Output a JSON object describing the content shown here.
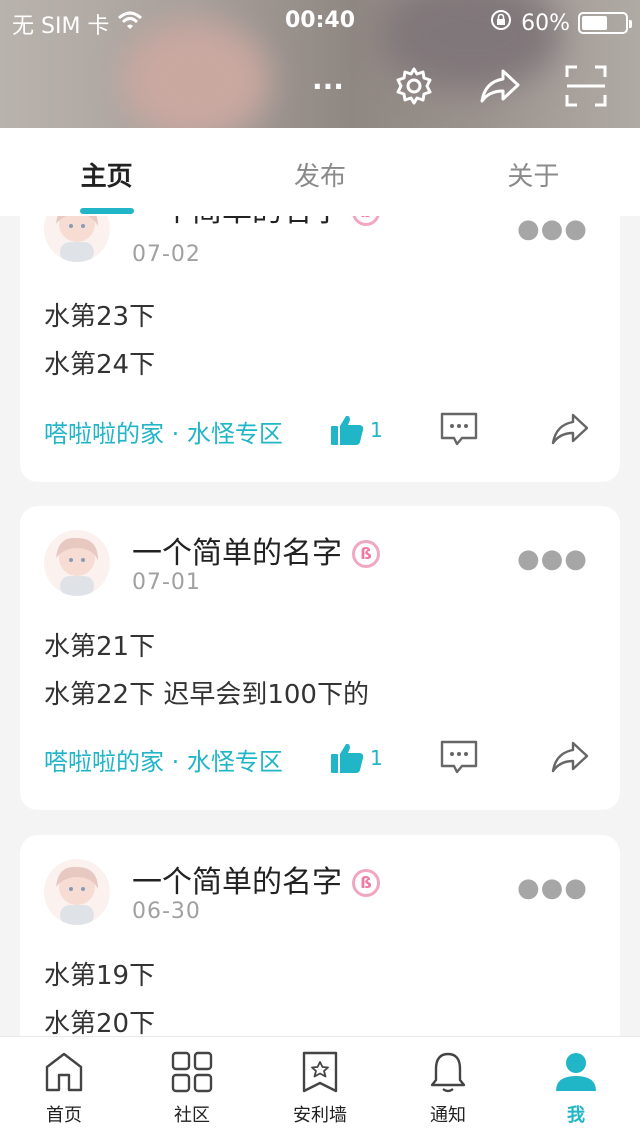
{
  "status_bar": {
    "carrier": "无 SIM 卡",
    "time": "00:40",
    "battery_percent": "60%",
    "battery_level": 0.6
  },
  "header": {
    "actions": [
      "more-icon",
      "gear-icon",
      "share-icon",
      "scan-icon"
    ],
    "more_label": "···"
  },
  "tabs": [
    {
      "label": "主页",
      "active": true
    },
    {
      "label": "发布",
      "active": false
    },
    {
      "label": "关于",
      "active": false
    }
  ],
  "posts": [
    {
      "author": "一个简单的名字",
      "badge": "ß",
      "date": "07-02",
      "lines": [
        "水第23下",
        "水第24下"
      ],
      "tags": "嗒啦啦的家 · 水怪专区",
      "likes": "1"
    },
    {
      "author": "一个简单的名字",
      "badge": "ß",
      "date": "07-01",
      "lines": [
        "水第21下",
        "水第22下 迟早会到100下的"
      ],
      "tags": "嗒啦啦的家 · 水怪专区",
      "likes": "1"
    },
    {
      "author": "一个简单的名字",
      "badge": "ß",
      "date": "06-30",
      "lines": [
        "水第19下",
        "水第20下"
      ],
      "tags": "",
      "likes": ""
    }
  ],
  "bottom_nav": [
    {
      "label": "首页",
      "icon": "home-icon"
    },
    {
      "label": "社区",
      "icon": "grid-icon"
    },
    {
      "label": "安利墙",
      "icon": "bookmark-star-icon"
    },
    {
      "label": "通知",
      "icon": "bell-icon"
    },
    {
      "label": "我",
      "icon": "person-icon",
      "active": true
    }
  ],
  "colors": {
    "accent": "#21b5c8",
    "badge": "#f07aa2"
  }
}
